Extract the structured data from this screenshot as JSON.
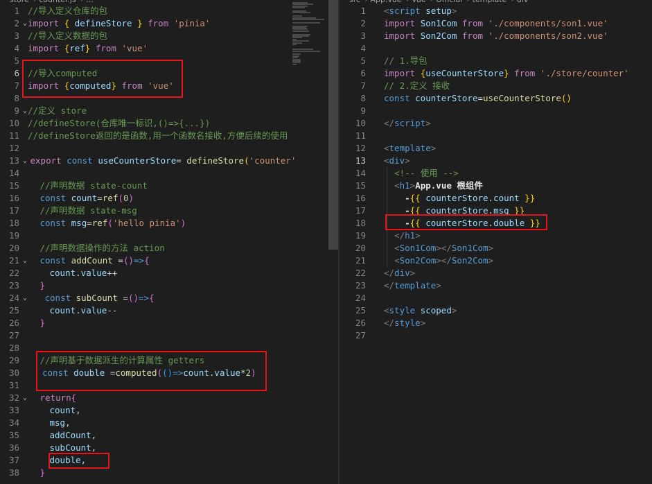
{
  "left_editor": {
    "breadcrumb": [
      "store",
      "counter.js",
      "..."
    ],
    "lines": [
      {
        "n": "1",
        "fold": "",
        "indent": 0,
        "tokens": [
          [
            "//导入定义仓库的包",
            "comment"
          ]
        ]
      },
      {
        "n": "2",
        "fold": "⌄",
        "indent": 0,
        "tokens": [
          [
            "import ",
            "kw2"
          ],
          [
            "{",
            "br1"
          ],
          [
            " defineStore ",
            "var"
          ],
          [
            "}",
            "br1"
          ],
          [
            " from ",
            "kw2"
          ],
          [
            "'pinia'",
            "str"
          ]
        ]
      },
      {
        "n": "3",
        "fold": "",
        "indent": 0,
        "tokens": [
          [
            "//导入定义数据的包",
            "comment"
          ]
        ]
      },
      {
        "n": "4",
        "fold": "",
        "indent": 0,
        "tokens": [
          [
            "import ",
            "kw2"
          ],
          [
            "{",
            "br1"
          ],
          [
            "ref",
            "var"
          ],
          [
            "}",
            "br1"
          ],
          [
            " from ",
            "kw2"
          ],
          [
            "'vue'",
            "str"
          ]
        ]
      },
      {
        "n": "5",
        "fold": "",
        "indent": 0,
        "tokens": []
      },
      {
        "n": "6",
        "fold": "",
        "indent": 0,
        "active": true,
        "tokens": [
          [
            "//导入computed",
            "comment"
          ]
        ]
      },
      {
        "n": "7",
        "fold": "",
        "indent": 0,
        "tokens": [
          [
            "import ",
            "kw2"
          ],
          [
            "{",
            "br1"
          ],
          [
            "computed",
            "var"
          ],
          [
            "}",
            "br1"
          ],
          [
            " from ",
            "kw2"
          ],
          [
            "'vue'",
            "str"
          ]
        ]
      },
      {
        "n": "8",
        "fold": "",
        "indent": 0,
        "tokens": []
      },
      {
        "n": "9",
        "fold": "⌄",
        "indent": 0,
        "tokens": [
          [
            "//定义 store",
            "comment"
          ]
        ]
      },
      {
        "n": "10",
        "fold": "",
        "indent": 0,
        "tokens": [
          [
            "//defineStore(仓库唯一标识,()=>{...})",
            "comment"
          ]
        ]
      },
      {
        "n": "11",
        "fold": "",
        "indent": 0,
        "tokens": [
          [
            "//defineStore返回的是函数,用一个函数名接收,方便后续的使用",
            "comment"
          ]
        ]
      },
      {
        "n": "12",
        "fold": "",
        "indent": 0,
        "tokens": []
      },
      {
        "n": "13",
        "fold": "⌄",
        "indent": 1,
        "tokens": [
          [
            "export ",
            "kw2"
          ],
          [
            "const ",
            "kw"
          ],
          [
            "useCounterStore",
            "var"
          ],
          [
            "= ",
            "plain"
          ],
          [
            "defineStore",
            "fn"
          ],
          [
            "(",
            "br1"
          ],
          [
            "'counter'",
            "str"
          ]
        ]
      },
      {
        "n": "14",
        "fold": "",
        "indent": 0,
        "tokens": []
      },
      {
        "n": "15",
        "fold": "",
        "indent": 5,
        "tokens": [
          [
            "//声明数据 state-count",
            "comment"
          ]
        ]
      },
      {
        "n": "16",
        "fold": "",
        "indent": 5,
        "tokens": [
          [
            "const ",
            "kw"
          ],
          [
            "count",
            "var"
          ],
          [
            "=",
            "plain"
          ],
          [
            "ref",
            "fn"
          ],
          [
            "(",
            "br2"
          ],
          [
            "0",
            "num"
          ],
          [
            ")",
            "br2"
          ]
        ]
      },
      {
        "n": "17",
        "fold": "",
        "indent": 5,
        "tokens": [
          [
            "//声明数据 state-msg",
            "comment"
          ]
        ]
      },
      {
        "n": "18",
        "fold": "",
        "indent": 5,
        "tokens": [
          [
            "const ",
            "kw"
          ],
          [
            "msg",
            "var"
          ],
          [
            "=",
            "plain"
          ],
          [
            "ref",
            "fn"
          ],
          [
            "(",
            "br2"
          ],
          [
            "'hello pinia'",
            "str"
          ],
          [
            ")",
            "br2"
          ]
        ]
      },
      {
        "n": "19",
        "fold": "",
        "indent": 0,
        "tokens": []
      },
      {
        "n": "20",
        "fold": "",
        "indent": 5,
        "tokens": [
          [
            "//声明数据操作的方法 action",
            "comment"
          ]
        ]
      },
      {
        "n": "21",
        "fold": "⌄",
        "indent": 5,
        "tokens": [
          [
            "const ",
            "kw"
          ],
          [
            "addCount",
            "fn"
          ],
          [
            " =",
            "plain"
          ],
          [
            "()",
            "br2"
          ],
          [
            "=>",
            "kw"
          ],
          [
            "{",
            "br2"
          ]
        ]
      },
      {
        "n": "22",
        "fold": "",
        "indent": 9,
        "tokens": [
          [
            "count",
            "var"
          ],
          [
            ".",
            "plain"
          ],
          [
            "value",
            "var"
          ],
          [
            "++",
            "plain"
          ]
        ]
      },
      {
        "n": "23",
        "fold": "",
        "indent": 5,
        "tokens": [
          [
            "}",
            "br2"
          ]
        ]
      },
      {
        "n": "24",
        "fold": "⌄",
        "indent": 7,
        "tokens": [
          [
            "const ",
            "kw"
          ],
          [
            "subCount",
            "fn"
          ],
          [
            " =",
            "plain"
          ],
          [
            "()",
            "br2"
          ],
          [
            "=>",
            "kw"
          ],
          [
            "{",
            "br2"
          ]
        ]
      },
      {
        "n": "25",
        "fold": "",
        "indent": 9,
        "tokens": [
          [
            "count",
            "var"
          ],
          [
            ".",
            "plain"
          ],
          [
            "value",
            "var"
          ],
          [
            "--",
            "plain"
          ]
        ]
      },
      {
        "n": "26",
        "fold": "",
        "indent": 5,
        "tokens": [
          [
            "}",
            "br2"
          ]
        ]
      },
      {
        "n": "27",
        "fold": "",
        "indent": 0,
        "tokens": []
      },
      {
        "n": "28",
        "fold": "",
        "indent": 0,
        "tokens": []
      },
      {
        "n": "29",
        "fold": "",
        "indent": 5,
        "tokens": [
          [
            "//声明基于数据派生的计算属性 getters",
            "comment"
          ]
        ]
      },
      {
        "n": "30",
        "fold": "",
        "indent": 6,
        "tokens": [
          [
            "const ",
            "kw"
          ],
          [
            "double",
            "var"
          ],
          [
            " =",
            "plain"
          ],
          [
            "computed",
            "fn"
          ],
          [
            "(",
            "br2"
          ],
          [
            "()",
            "br3"
          ],
          [
            "=>",
            "kw"
          ],
          [
            "count",
            "var"
          ],
          [
            ".",
            "plain"
          ],
          [
            "value",
            "var"
          ],
          [
            "*",
            "plain"
          ],
          [
            "2",
            "num"
          ],
          [
            ")",
            "br2"
          ]
        ]
      },
      {
        "n": "31",
        "fold": "",
        "indent": 0,
        "tokens": []
      },
      {
        "n": "32",
        "fold": "⌄",
        "indent": 5,
        "tokens": [
          [
            "return",
            "kw2"
          ],
          [
            "{",
            "br2"
          ]
        ]
      },
      {
        "n": "33",
        "fold": "",
        "indent": 9,
        "tokens": [
          [
            "count",
            "var"
          ],
          [
            ",",
            "plain"
          ]
        ]
      },
      {
        "n": "34",
        "fold": "",
        "indent": 9,
        "tokens": [
          [
            "msg",
            "var"
          ],
          [
            ",",
            "plain"
          ]
        ]
      },
      {
        "n": "35",
        "fold": "",
        "indent": 9,
        "tokens": [
          [
            "addCount",
            "var"
          ],
          [
            ",",
            "plain"
          ]
        ]
      },
      {
        "n": "36",
        "fold": "",
        "indent": 9,
        "tokens": [
          [
            "subCount",
            "var"
          ],
          [
            ",",
            "plain"
          ]
        ]
      },
      {
        "n": "37",
        "fold": "",
        "indent": 9,
        "tokens": [
          [
            "double",
            "var"
          ],
          [
            ",",
            "plain"
          ]
        ]
      },
      {
        "n": "38",
        "fold": "",
        "indent": 5,
        "tokens": [
          [
            "}",
            "br2"
          ]
        ]
      }
    ]
  },
  "right_editor": {
    "breadcrumb": [
      "src",
      "App.vue",
      "Vue",
      "Official",
      "template",
      "div"
    ],
    "lines": [
      {
        "n": "1",
        "tokens": [
          [
            "<",
            "tagb"
          ],
          [
            "script ",
            "tag"
          ],
          [
            "setup",
            "var"
          ],
          [
            ">",
            "tagb"
          ]
        ]
      },
      {
        "n": "2",
        "tokens": [
          [
            "import ",
            "kw2"
          ],
          [
            "Son1Com ",
            "var"
          ],
          [
            "from ",
            "kw2"
          ],
          [
            "'./components/son1.vue'",
            "str"
          ]
        ]
      },
      {
        "n": "3",
        "tokens": [
          [
            "import ",
            "kw2"
          ],
          [
            "Son2Com ",
            "var"
          ],
          [
            "from ",
            "kw2"
          ],
          [
            "'./components/son2.vue'",
            "str"
          ]
        ]
      },
      {
        "n": "4",
        "tokens": []
      },
      {
        "n": "5",
        "tokens": [
          [
            "// 1.导包",
            "comment"
          ]
        ]
      },
      {
        "n": "6",
        "tokens": [
          [
            "import ",
            "kw2"
          ],
          [
            "{",
            "br1"
          ],
          [
            "useCounterStore",
            "var"
          ],
          [
            "}",
            "br1"
          ],
          [
            " from ",
            "kw2"
          ],
          [
            "'./store/counter'",
            "str"
          ]
        ]
      },
      {
        "n": "7",
        "tokens": [
          [
            "// 2.定义 接收",
            "comment"
          ]
        ]
      },
      {
        "n": "8",
        "tokens": [
          [
            "const ",
            "kw"
          ],
          [
            "counterStore",
            "var"
          ],
          [
            "=",
            "plain"
          ],
          [
            "useCounterStore",
            "fn"
          ],
          [
            "()",
            "br1"
          ]
        ]
      },
      {
        "n": "9",
        "tokens": []
      },
      {
        "n": "10",
        "tokens": [
          [
            "</",
            "tagb"
          ],
          [
            "script",
            "tag"
          ],
          [
            ">",
            "tagb"
          ]
        ]
      },
      {
        "n": "11",
        "tokens": []
      },
      {
        "n": "12",
        "tokens": [
          [
            "<",
            "tagb"
          ],
          [
            "template",
            "tag"
          ],
          [
            ">",
            "tagb"
          ]
        ]
      },
      {
        "n": "13",
        "active": true,
        "tokens": [
          [
            "<",
            "tagb"
          ],
          [
            "div",
            "tag"
          ],
          [
            ">",
            "tagb"
          ]
        ]
      },
      {
        "n": "14",
        "tokens": [
          [
            "  ",
            "plain"
          ],
          [
            "<!-- 使用 -->",
            "comment"
          ]
        ]
      },
      {
        "n": "15",
        "tokens": [
          [
            "  ",
            "plain"
          ],
          [
            "<",
            "tagb"
          ],
          [
            "h1",
            "tag"
          ],
          [
            ">",
            "tagb"
          ],
          [
            "App.vue 根组件",
            "white"
          ]
        ]
      },
      {
        "n": "16",
        "tokens": [
          [
            "    ",
            "plain"
          ],
          [
            "-",
            "white"
          ],
          [
            "{{",
            "br1"
          ],
          [
            " counterStore",
            "var"
          ],
          [
            ".",
            "plain"
          ],
          [
            "count",
            "var"
          ],
          [
            " }}",
            "br1"
          ]
        ]
      },
      {
        "n": "17",
        "tokens": [
          [
            "    ",
            "plain"
          ],
          [
            "-",
            "white"
          ],
          [
            "{{",
            "br1"
          ],
          [
            " counterStore",
            "var"
          ],
          [
            ".",
            "plain"
          ],
          [
            "msg",
            "var"
          ],
          [
            " }}",
            "br1"
          ]
        ]
      },
      {
        "n": "18",
        "tokens": [
          [
            "    ",
            "plain"
          ],
          [
            "-",
            "white"
          ],
          [
            "{{",
            "br1"
          ],
          [
            " counterStore",
            "var"
          ],
          [
            ".",
            "plain"
          ],
          [
            "double",
            "var"
          ],
          [
            " }}",
            "br1"
          ]
        ]
      },
      {
        "n": "19",
        "tokens": [
          [
            "  ",
            "plain"
          ],
          [
            "</",
            "tagb"
          ],
          [
            "h1",
            "tag"
          ],
          [
            ">",
            "tagb"
          ]
        ]
      },
      {
        "n": "20",
        "tokens": [
          [
            "  ",
            "plain"
          ],
          [
            "<",
            "tagb"
          ],
          [
            "Son1Com",
            "tag"
          ],
          [
            "></",
            "tagb"
          ],
          [
            "Son1Com",
            "tag"
          ],
          [
            ">",
            "tagb"
          ]
        ]
      },
      {
        "n": "21",
        "tokens": [
          [
            "  ",
            "plain"
          ],
          [
            "<",
            "tagb"
          ],
          [
            "Son2Com",
            "tag"
          ],
          [
            "></",
            "tagb"
          ],
          [
            "Son2Com",
            "tag"
          ],
          [
            ">",
            "tagb"
          ]
        ]
      },
      {
        "n": "22",
        "tokens": [
          [
            "</",
            "tagb"
          ],
          [
            "div",
            "tag"
          ],
          [
            ">",
            "tagb"
          ]
        ]
      },
      {
        "n": "23",
        "tokens": [
          [
            "</",
            "tagb"
          ],
          [
            "template",
            "tag"
          ],
          [
            ">",
            "tagb"
          ]
        ]
      },
      {
        "n": "24",
        "tokens": []
      },
      {
        "n": "25",
        "tokens": [
          [
            "<",
            "tagb"
          ],
          [
            "style ",
            "tag"
          ],
          [
            "scoped",
            "var"
          ],
          [
            ">",
            "tagb"
          ]
        ]
      },
      {
        "n": "26",
        "tokens": [
          [
            "</",
            "tagb"
          ],
          [
            "style",
            "tag"
          ],
          [
            ">",
            "tagb"
          ]
        ]
      },
      {
        "n": "27",
        "tokens": []
      }
    ]
  },
  "icons": {
    "fold_open": "chevron-down-icon"
  },
  "colors": {
    "annotation_box": "#e8141c",
    "editor_bg": "#1e1e1e"
  }
}
